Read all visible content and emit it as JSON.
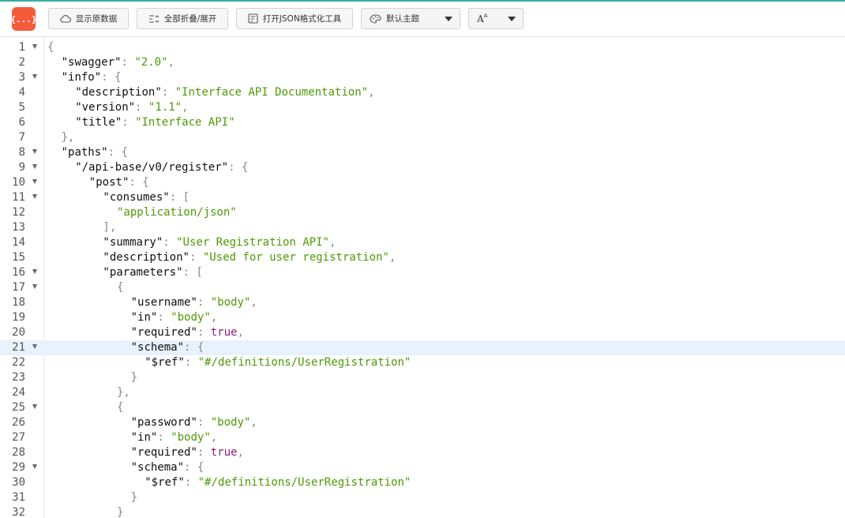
{
  "toolbar": {
    "logo_text": "{...}",
    "show_raw": "显示原数据",
    "collapse_all": "全部折叠/展开",
    "open_tool": "打开JSON格式化工具",
    "theme": "默认主题",
    "font": "A"
  },
  "editor": {
    "active_line": 21,
    "lines": [
      {
        "n": "1",
        "indent": 0,
        "fold": true,
        "t": [
          [
            "p",
            "{"
          ]
        ]
      },
      {
        "n": "2",
        "indent": 1,
        "fold": false,
        "t": [
          [
            "k",
            "\"swagger\""
          ],
          [
            "p",
            ": "
          ],
          [
            "s",
            "\"2.0\""
          ],
          [
            "p",
            ","
          ]
        ]
      },
      {
        "n": "3",
        "indent": 1,
        "fold": true,
        "t": [
          [
            "k",
            "\"info\""
          ],
          [
            "p",
            ": {"
          ]
        ]
      },
      {
        "n": "4",
        "indent": 2,
        "fold": false,
        "t": [
          [
            "k",
            "\"description\""
          ],
          [
            "p",
            ": "
          ],
          [
            "s",
            "\"Interface API Documentation\""
          ],
          [
            "p",
            ","
          ]
        ]
      },
      {
        "n": "5",
        "indent": 2,
        "fold": false,
        "t": [
          [
            "k",
            "\"version\""
          ],
          [
            "p",
            ": "
          ],
          [
            "s",
            "\"1.1\""
          ],
          [
            "p",
            ","
          ]
        ]
      },
      {
        "n": "6",
        "indent": 2,
        "fold": false,
        "t": [
          [
            "k",
            "\"title\""
          ],
          [
            "p",
            ": "
          ],
          [
            "s",
            "\"Interface API\""
          ]
        ]
      },
      {
        "n": "7",
        "indent": 1,
        "fold": false,
        "t": [
          [
            "p",
            "},"
          ]
        ]
      },
      {
        "n": "8",
        "indent": 1,
        "fold": true,
        "t": [
          [
            "k",
            "\"paths\""
          ],
          [
            "p",
            ": {"
          ]
        ]
      },
      {
        "n": "9",
        "indent": 2,
        "fold": true,
        "t": [
          [
            "k",
            "\"/api-base/v0/register\""
          ],
          [
            "p",
            ": {"
          ]
        ]
      },
      {
        "n": "10",
        "indent": 3,
        "fold": true,
        "t": [
          [
            "k",
            "\"post\""
          ],
          [
            "p",
            ": {"
          ]
        ]
      },
      {
        "n": "11",
        "indent": 4,
        "fold": true,
        "t": [
          [
            "k",
            "\"consumes\""
          ],
          [
            "p",
            ": ["
          ]
        ]
      },
      {
        "n": "12",
        "indent": 5,
        "fold": false,
        "t": [
          [
            "s",
            "\"application/json\""
          ]
        ]
      },
      {
        "n": "13",
        "indent": 4,
        "fold": false,
        "t": [
          [
            "p",
            "],"
          ]
        ]
      },
      {
        "n": "14",
        "indent": 4,
        "fold": false,
        "t": [
          [
            "k",
            "\"summary\""
          ],
          [
            "p",
            ": "
          ],
          [
            "s",
            "\"User Registration API\""
          ],
          [
            "p",
            ","
          ]
        ]
      },
      {
        "n": "15",
        "indent": 4,
        "fold": false,
        "t": [
          [
            "k",
            "\"description\""
          ],
          [
            "p",
            ": "
          ],
          [
            "s",
            "\"Used for user registration\""
          ],
          [
            "p",
            ","
          ]
        ]
      },
      {
        "n": "16",
        "indent": 4,
        "fold": true,
        "t": [
          [
            "k",
            "\"parameters\""
          ],
          [
            "p",
            ": ["
          ]
        ]
      },
      {
        "n": "17",
        "indent": 5,
        "fold": true,
        "t": [
          [
            "p",
            "{"
          ]
        ]
      },
      {
        "n": "18",
        "indent": 6,
        "fold": false,
        "t": [
          [
            "k",
            "\"username\""
          ],
          [
            "p",
            ": "
          ],
          [
            "s",
            "\"body\""
          ],
          [
            "p",
            ","
          ]
        ]
      },
      {
        "n": "19",
        "indent": 6,
        "fold": false,
        "t": [
          [
            "k",
            "\"in\""
          ],
          [
            "p",
            ": "
          ],
          [
            "s",
            "\"body\""
          ],
          [
            "p",
            ","
          ]
        ]
      },
      {
        "n": "20",
        "indent": 6,
        "fold": false,
        "t": [
          [
            "k",
            "\"required\""
          ],
          [
            "p",
            ": "
          ],
          [
            "b",
            "true"
          ],
          [
            "p",
            ","
          ]
        ]
      },
      {
        "n": "21",
        "indent": 6,
        "fold": true,
        "t": [
          [
            "k",
            "\"schema\""
          ],
          [
            "p",
            ": {"
          ]
        ]
      },
      {
        "n": "22",
        "indent": 7,
        "fold": false,
        "t": [
          [
            "k",
            "\"$ref\""
          ],
          [
            "p",
            ": "
          ],
          [
            "s",
            "\"#/definitions/UserRegistration\""
          ]
        ]
      },
      {
        "n": "23",
        "indent": 6,
        "fold": false,
        "t": [
          [
            "p",
            "}"
          ]
        ]
      },
      {
        "n": "24",
        "indent": 5,
        "fold": false,
        "t": [
          [
            "p",
            "},"
          ]
        ]
      },
      {
        "n": "25",
        "indent": 5,
        "fold": true,
        "t": [
          [
            "p",
            "{"
          ]
        ]
      },
      {
        "n": "26",
        "indent": 6,
        "fold": false,
        "t": [
          [
            "k",
            "\"password\""
          ],
          [
            "p",
            ": "
          ],
          [
            "s",
            "\"body\""
          ],
          [
            "p",
            ","
          ]
        ]
      },
      {
        "n": "27",
        "indent": 6,
        "fold": false,
        "t": [
          [
            "k",
            "\"in\""
          ],
          [
            "p",
            ": "
          ],
          [
            "s",
            "\"body\""
          ],
          [
            "p",
            ","
          ]
        ]
      },
      {
        "n": "28",
        "indent": 6,
        "fold": false,
        "t": [
          [
            "k",
            "\"required\""
          ],
          [
            "p",
            ": "
          ],
          [
            "b",
            "true"
          ],
          [
            "p",
            ","
          ]
        ]
      },
      {
        "n": "29",
        "indent": 6,
        "fold": true,
        "t": [
          [
            "k",
            "\"schema\""
          ],
          [
            "p",
            ": {"
          ]
        ]
      },
      {
        "n": "30",
        "indent": 7,
        "fold": false,
        "t": [
          [
            "k",
            "\"$ref\""
          ],
          [
            "p",
            ": "
          ],
          [
            "s",
            "\"#/definitions/UserRegistration\""
          ]
        ]
      },
      {
        "n": "31",
        "indent": 6,
        "fold": false,
        "t": [
          [
            "p",
            "}"
          ]
        ]
      },
      {
        "n": "32",
        "indent": 5,
        "fold": false,
        "t": [
          [
            "p",
            "}"
          ]
        ]
      }
    ]
  }
}
